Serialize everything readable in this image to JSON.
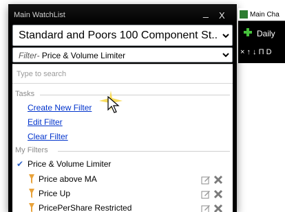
{
  "window": {
    "title": "Main WatchList",
    "minimize_glyph": "_",
    "close_glyph": "X"
  },
  "watchlist_combo": {
    "value": "Standard and Poors 100 Component St...",
    "arrow": "chevron-down-icon"
  },
  "filter_combo": {
    "prefix": "Filter-",
    "value": "Price & Volume Limiter",
    "arrow": "chevron-down-icon"
  },
  "search": {
    "placeholder": "Type to search"
  },
  "tasks": {
    "header": "Tasks",
    "items": [
      {
        "label": "Create New Filter"
      },
      {
        "label": "Edit Filter"
      },
      {
        "label": "Clear Filter"
      }
    ]
  },
  "my_filters": {
    "header": "My Filters",
    "active": {
      "label": "Price & Volume Limiter",
      "checked": true
    },
    "items": [
      {
        "label": "Price above MA"
      },
      {
        "label": "Price Up"
      },
      {
        "label": "PricePerShare Restricted"
      }
    ]
  },
  "chart_panel": {
    "tab_title": "Main Cha",
    "period": "Daily",
    "tool_glyphs": "× ↑ ↓ Π D"
  },
  "colors": {
    "link": "#0033cc",
    "accent_check": "#2f62c7",
    "window_bg": "#000000",
    "filter_icon": "#e8a23a",
    "add_icon": "#46c13b"
  }
}
